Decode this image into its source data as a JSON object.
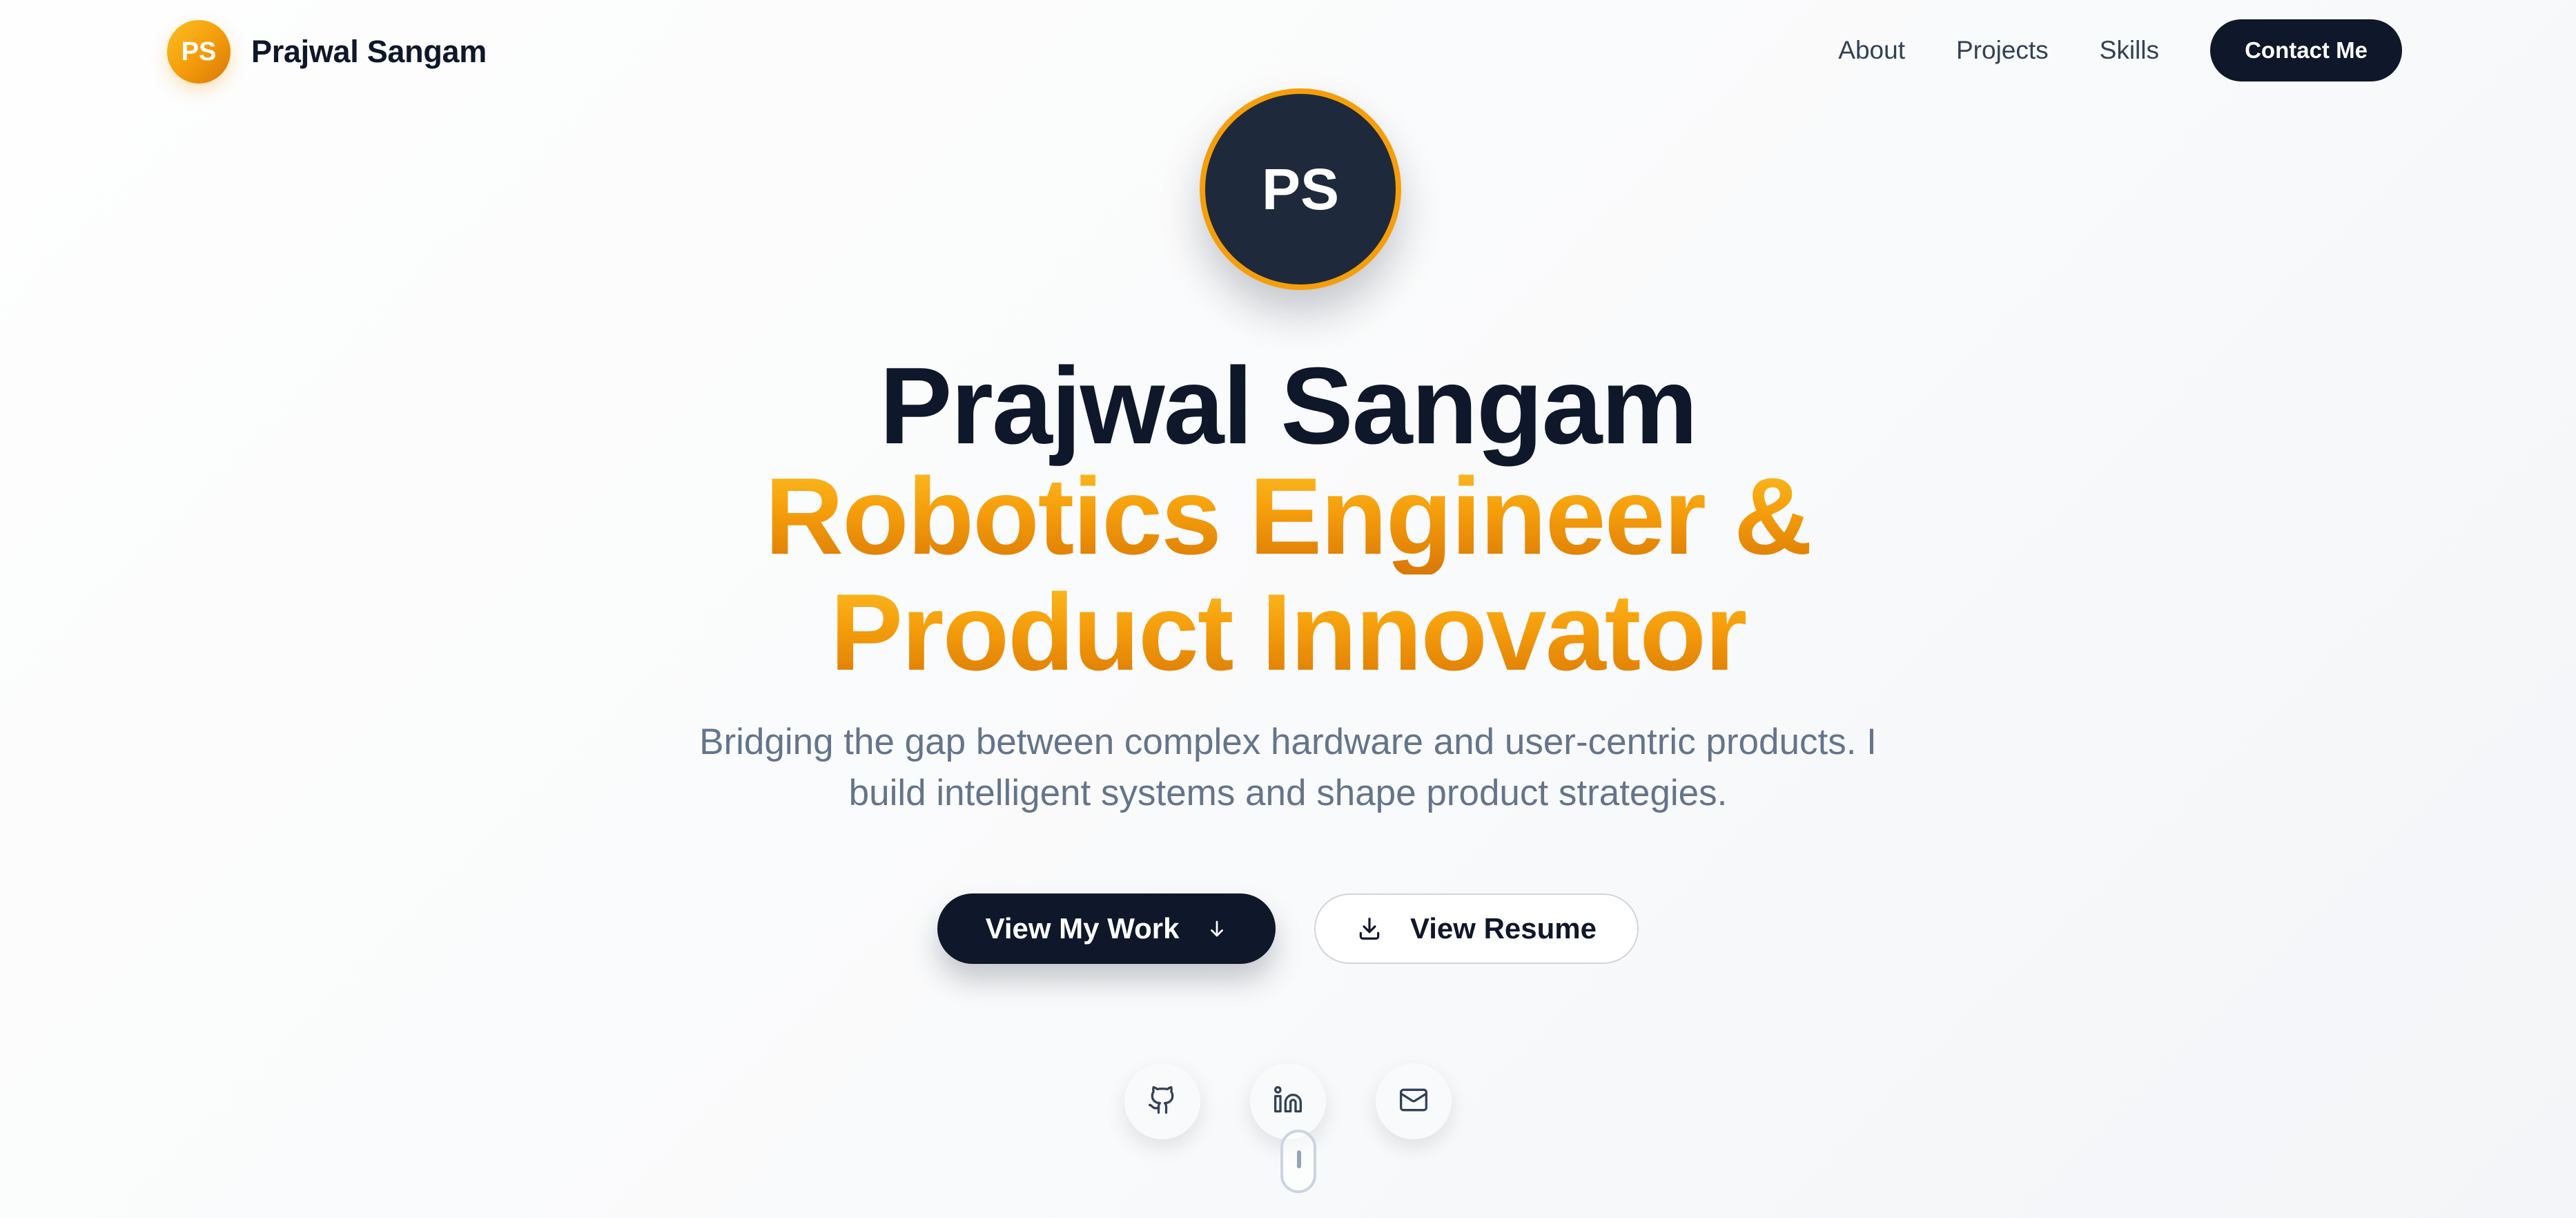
{
  "nav": {
    "logo_text": "PS",
    "brand_name": "Prajwal Sangam",
    "links": [
      "About",
      "Projects",
      "Skills"
    ],
    "cta_label": "Contact Me"
  },
  "hero": {
    "avatar_initials": "PS",
    "name": "Prajwal Sangam",
    "role_line1": "Robotics Engineer &",
    "role_line2": "Product Innovator",
    "tagline_line1": "Bridging the gap between complex hardware and user-centric products. I",
    "tagline_line2": "build intelligent systems and shape product strategies.",
    "primary_button": "View My Work",
    "secondary_button": "View Resume"
  },
  "socials": {
    "items": [
      "github-icon",
      "linkedin-icon",
      "mail-icon"
    ]
  },
  "colors": {
    "accent": "#f59e0b",
    "accent_light": "#fbbf24",
    "accent_dark": "#d97706",
    "navy": "#0f172a",
    "text_muted": "#64748b"
  }
}
